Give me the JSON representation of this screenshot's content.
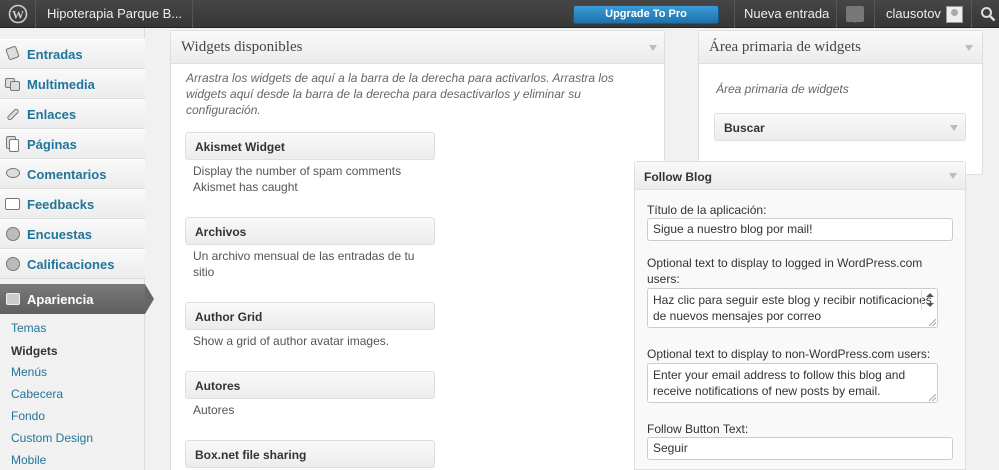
{
  "adminbar": {
    "site_name": "Hipoterapia Parque B...",
    "upgrade_label": "Upgrade To Pro",
    "new_entry_label": "Nueva entrada",
    "username": "clausotov",
    "icons": [
      "wordpress-logo-icon",
      "notification-icon",
      "avatar",
      "search-icon"
    ]
  },
  "sidebar": {
    "items": [
      {
        "label": "Entradas",
        "icon": "pin-icon"
      },
      {
        "label": "Multimedia",
        "icon": "media-icon"
      },
      {
        "label": "Enlaces",
        "icon": "link-icon"
      },
      {
        "label": "Páginas",
        "icon": "pages-icon"
      },
      {
        "label": "Comentarios",
        "icon": "comment-icon"
      },
      {
        "label": "Feedbacks",
        "icon": "feedback-icon"
      },
      {
        "label": "Encuestas",
        "icon": "poll-icon"
      },
      {
        "label": "Calificaciones",
        "icon": "rating-icon"
      }
    ],
    "active": {
      "label": "Apariencia",
      "icon": "appearance-icon"
    },
    "submenu": [
      "Temas",
      "Widgets",
      "Menús",
      "Cabecera",
      "Fondo",
      "Custom Design",
      "Mobile"
    ],
    "current_submenu": "Widgets"
  },
  "available": {
    "title": "Widgets disponibles",
    "description": "Arrastra los widgets de aquí a la barra de la derecha para activarlos. Arrastra los widgets aquí desde la barra de la derecha para desactivarlos y eliminar su configuración.",
    "widgets": [
      {
        "title": "Akismet Widget",
        "desc": "Display the number of spam comments Akismet has caught"
      },
      {
        "title": "Archivos",
        "desc": "Un archivo mensual de las entradas de tu sitio"
      },
      {
        "title": "Author Grid",
        "desc": "Show a grid of author avatar images."
      },
      {
        "title": "Autores",
        "desc": "Autores"
      },
      {
        "title": "Box.net file sharing",
        "desc": ""
      }
    ]
  },
  "primary": {
    "title": "Área primaria de widgets",
    "description": "Área primaria de widgets",
    "widgets": [
      {
        "title": "Buscar"
      }
    ]
  },
  "follow_blog": {
    "title": "Follow Blog",
    "app_title_label": "Título de la aplicación:",
    "app_title_value": "Sigue a nuestro blog por mail!",
    "logged_label": "Optional text to display to logged in WordPress.com users:",
    "logged_value": "Haz clic para seguir este blog y recibir notificaciones de nuevos mensajes por correo",
    "non_logged_label": "Optional text to display to non-WordPress.com users:",
    "non_logged_value": "Enter your email address to follow this blog and receive notifications of new posts by email.",
    "button_text_label": "Follow Button Text:",
    "button_text_value": "Seguir"
  }
}
